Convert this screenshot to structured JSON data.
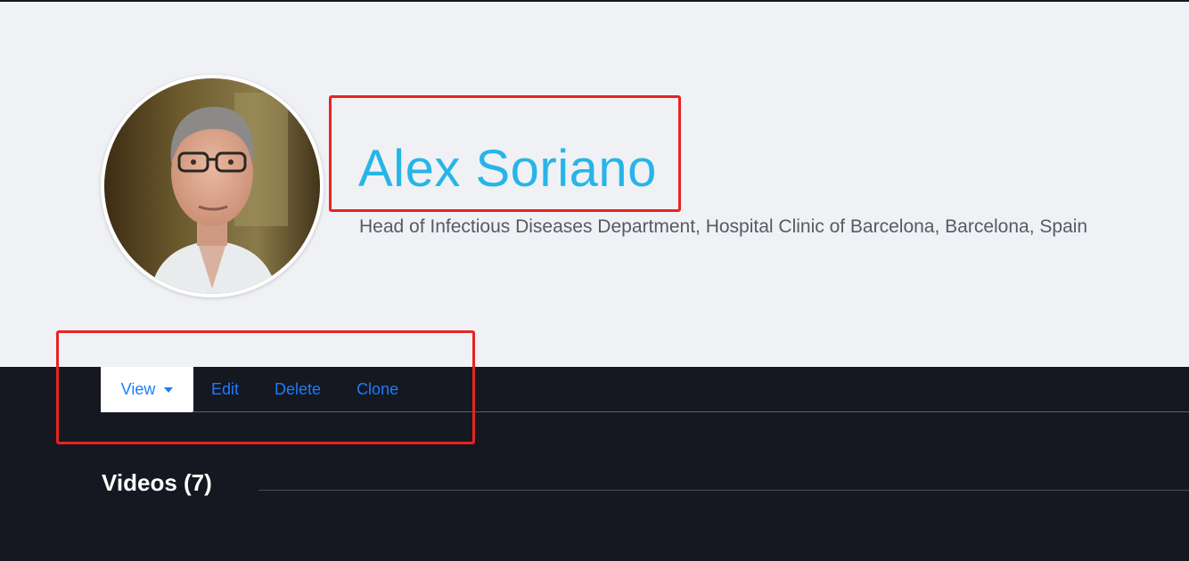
{
  "profile": {
    "name": "Alex Soriano",
    "title": "Head of Infectious Diseases Department, Hospital Clinic of Barcelona, Barcelona, Spain",
    "avatar_alt": "Alex Soriano"
  },
  "tabs": [
    {
      "label": "View",
      "active": true,
      "has_dropdown": true
    },
    {
      "label": "Edit",
      "active": false
    },
    {
      "label": "Delete",
      "active": false
    },
    {
      "label": "Clone",
      "active": false
    }
  ],
  "videos_section": {
    "title": "Videos (7)"
  },
  "colors": {
    "name": "#27b5e8",
    "tab_link": "#1a7cff",
    "dark_background": "#151821",
    "header_background": "#f0f1f5",
    "annotation": "#e62420"
  },
  "icons": {
    "dropdown": "caret-down-icon"
  }
}
